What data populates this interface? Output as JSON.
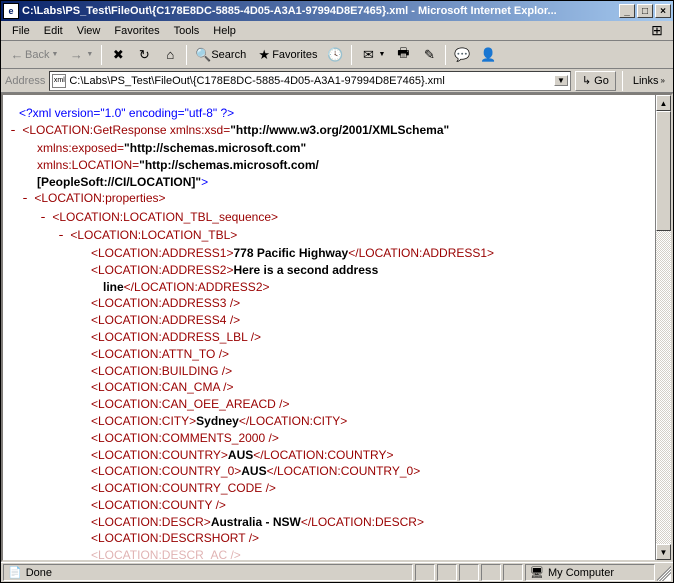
{
  "titlebar": {
    "title": "C:\\Labs\\PS_Test\\FileOut\\{C178E8DC-5885-4D05-A3A1-97994D8E7465}.xml - Microsoft Internet Explor..."
  },
  "menu": {
    "file": "File",
    "edit": "Edit",
    "view": "View",
    "favorites": "Favorites",
    "tools": "Tools",
    "help": "Help"
  },
  "toolbar": {
    "back": "Back",
    "search": "Search",
    "favorites": "Favorites"
  },
  "addressbar": {
    "label": "Address",
    "value": "C:\\Labs\\PS_Test\\FileOut\\{C178E8DC-5885-4D05-A3A1-97994D8E7465}.xml",
    "go": "Go",
    "links": "Links"
  },
  "xml": {
    "decl": "<?xml version=\"1.0\" encoding=\"utf-8\" ?>",
    "root_open": "<LOCATION:GetResponse",
    "xmlns_xsd_attr": " xmlns:xsd=",
    "xmlns_xsd_val": "\"http://www.w3.org/2001/XMLSchema\"",
    "xmlns_exposed_attr": "xmlns:exposed=",
    "xmlns_exposed_val": "\"http://schemas.microsoft.com\"",
    "xmlns_location_attr": "xmlns:LOCATION=",
    "xmlns_location_val1": "\"http://schemas.microsoft.com/",
    "xmlns_location_val2": "[PeopleSoft://CI/LOCATION]\"",
    "props_open": "<LOCATION:properties>",
    "seq_open": "<LOCATION:LOCATION_TBL_sequence>",
    "tbl_open": "<LOCATION:LOCATION_TBL>",
    "addr1_open": "<LOCATION:ADDRESS1>",
    "addr1_val": "778 Pacific Highway",
    "addr1_close": "</LOCATION:ADDRESS1>",
    "addr2_open": "<LOCATION:ADDRESS2>",
    "addr2_val1": "Here is a second address",
    "addr2_val2": "line",
    "addr2_close": "</LOCATION:ADDRESS2>",
    "addr3": "<LOCATION:ADDRESS3 />",
    "addr4": "<LOCATION:ADDRESS4 />",
    "addr_lbl": "<LOCATION:ADDRESS_LBL />",
    "attn_to": "<LOCATION:ATTN_TO />",
    "building": "<LOCATION:BUILDING />",
    "can_cma": "<LOCATION:CAN_CMA />",
    "can_oee": "<LOCATION:CAN_OEE_AREACD />",
    "city_open": "<LOCATION:CITY>",
    "city_val": "Sydney",
    "city_close": "</LOCATION:CITY>",
    "comments": "<LOCATION:COMMENTS_2000 />",
    "country_open": "<LOCATION:COUNTRY>",
    "country_val": "AUS",
    "country_close": "</LOCATION:COUNTRY>",
    "country0_open": "<LOCATION:COUNTRY_0>",
    "country0_val": "AUS",
    "country0_close": "</LOCATION:COUNTRY_0>",
    "country_code": "<LOCATION:COUNTRY_CODE />",
    "county": "<LOCATION:COUNTY />",
    "descr_open": "<LOCATION:DESCR>",
    "descr_val": "Australia - NSW",
    "descr_close": "</LOCATION:DESCR>",
    "descrshort": "<LOCATION:DESCRSHORT />",
    "descr_ac_partial": "<LOCATION:DESCR_AC />"
  },
  "statusbar": {
    "done": "Done",
    "zone": "My Computer"
  }
}
